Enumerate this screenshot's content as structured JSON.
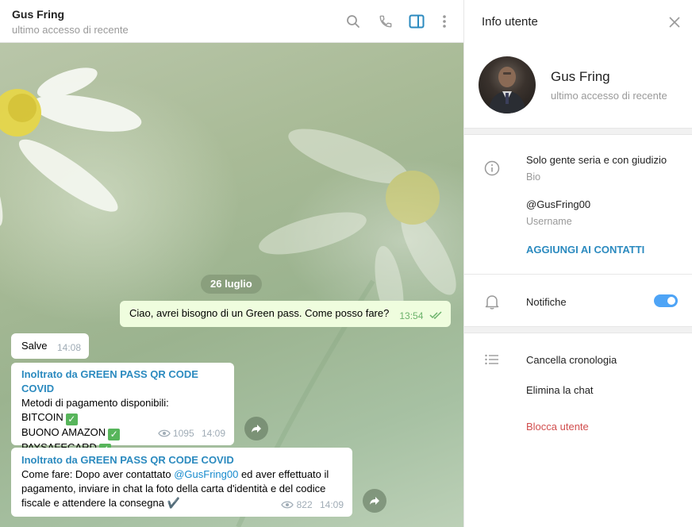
{
  "header": {
    "title": "Gus Fring",
    "status": "ultimo accesso di recente",
    "icons": [
      "search-icon",
      "phone-icon",
      "sidebar-toggle-icon",
      "more-vertical-icon"
    ]
  },
  "chat": {
    "date": "26 luglio",
    "messages": [
      {
        "id": "m1",
        "direction": "out",
        "text": "Ciao, avrei bisogno di un Green pass. Come posso fare?",
        "time": "13:54"
      },
      {
        "id": "m2",
        "direction": "in",
        "text": "Salve",
        "time": "14:08"
      },
      {
        "id": "m3",
        "direction": "in",
        "forwarded_from": "Inoltrato da GREEN PASS QR CODE COVID",
        "lines": [
          "Metodi di pagamento disponibili:",
          "BITCOIN",
          "BUONO AMAZON",
          "PAYSAFECARD"
        ],
        "check_emoji": "✓",
        "views": "1095",
        "time": "14:09"
      },
      {
        "id": "m4",
        "direction": "in",
        "forwarded_from": "Inoltrato da GREEN PASS QR CODE COVID",
        "text_pre": "Come fare: Dopo aver contattato ",
        "mention": "@GusFring00",
        "text_post_1": " ed aver effettuato il",
        "text_line_2": "pagamento, inviare in chat la foto della carta d'identità e del codice",
        "text_line_3": "fiscale e attendere la consegna ✔️",
        "views": "822",
        "time": "14:09"
      }
    ]
  },
  "info": {
    "title": "Info utente",
    "name": "Gus Fring",
    "status": "ultimo accesso di recente",
    "bio": "Solo gente seria e con giudizio",
    "bio_label": "Bio",
    "username": "@GusFring00",
    "username_label": "Username",
    "add_contact": "AGGIUNGI AI CONTATTI",
    "notifications_label": "Notifiche",
    "notifications_on": true,
    "clear_history": "Cancella cronologia",
    "delete_chat": "Elimina la chat",
    "block_user": "Blocca utente"
  },
  "colors": {
    "accent": "#2b8abf",
    "toggle": "#4ea4f6",
    "outgoing_bubble": "#effdde",
    "danger": "#d14e4e"
  }
}
